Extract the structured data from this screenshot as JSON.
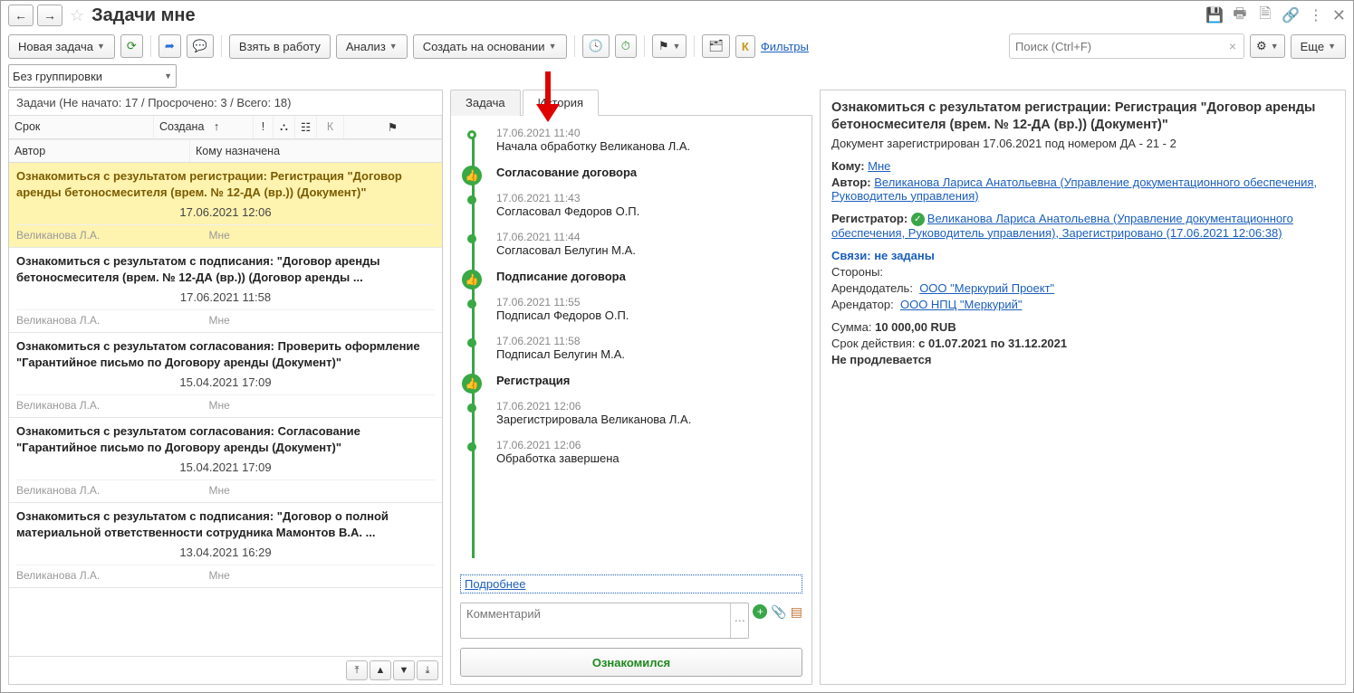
{
  "page_title": "Задачи мне",
  "toolbar": {
    "new_task": "Новая задача",
    "take_work": "Взять в работу",
    "analysis": "Анализ",
    "create_based": "Создать на основании",
    "filters": "Фильтры",
    "more": "Еще"
  },
  "search": {
    "placeholder": "Поиск (Ctrl+F)"
  },
  "grouping": {
    "value": "Без группировки"
  },
  "task_summary": "Задачи (Не начато: 17 / Просрочено: 3 / Всего: 18)",
  "columns": {
    "due": "Срок",
    "created": "Создана",
    "author": "Автор",
    "assigned": "Кому назначена",
    "k": "К"
  },
  "tasks": [
    {
      "title": "Ознакомиться с результатом регистрации: Регистрация \"Договор аренды бетоносмесителя (врем. № 12-ДА (вр.)) (Документ)\"",
      "date": "17.06.2021 12:06",
      "author": "Великанова Л.А.",
      "to": "Мне",
      "selected": true
    },
    {
      "title": "Ознакомиться с результатом с подписания: \"Договор аренды бетоносмесителя (врем. № 12-ДА (вр.)) (Договор аренды ...",
      "date": "17.06.2021 11:58",
      "author": "Великанова Л.А.",
      "to": "Мне"
    },
    {
      "title": "Ознакомиться с результатом согласования: Проверить оформление \"Гарантийное письмо по Договору аренды (Документ)\"",
      "date": "15.04.2021 17:09",
      "author": "Великанова Л.А.",
      "to": "Мне"
    },
    {
      "title": "Ознакомиться с результатом согласования: Согласование \"Гарантийное письмо по Договору аренды (Документ)\"",
      "date": "15.04.2021 17:09",
      "author": "Великанова Л.А.",
      "to": "Мне"
    },
    {
      "title": "Ознакомиться с результатом с подписания: \"Договор о полной материальной ответственности сотрудника Мамонтов В.А. ...",
      "date": "13.04.2021 16:29",
      "author": "Великанова Л.А.",
      "to": "Мне"
    }
  ],
  "tabs": {
    "task": "Задача",
    "history": "История"
  },
  "timeline": [
    {
      "type": "start",
      "dt": "17.06.2021 11:40",
      "txt": "Начала обработку Великанова Л.А."
    },
    {
      "type": "stage",
      "txt": "Согласование договора"
    },
    {
      "type": "item",
      "dt": "17.06.2021 11:43",
      "txt": "Согласовал Федоров О.П."
    },
    {
      "type": "item",
      "dt": "17.06.2021 11:44",
      "txt": "Согласовал Белугин М.А."
    },
    {
      "type": "stage",
      "txt": "Подписание договора"
    },
    {
      "type": "item",
      "dt": "17.06.2021 11:55",
      "txt": "Подписал Федоров О.П."
    },
    {
      "type": "item",
      "dt": "17.06.2021 11:58",
      "txt": "Подписал Белугин М.А."
    },
    {
      "type": "stage",
      "txt": "Регистрация"
    },
    {
      "type": "item",
      "dt": "17.06.2021 12:06",
      "txt": "Зарегистрировала Великанова Л.А."
    },
    {
      "type": "end",
      "dt": "17.06.2021 12:06",
      "txt": "Обработка завершена"
    }
  ],
  "more_link": "Подробнее",
  "comment_placeholder": "Комментарий",
  "ack_button": "Ознакомился",
  "details": {
    "title": "Ознакомиться с результатом регистрации: Регистрация \"Договор аренды бетоносмесителя (врем. № 12-ДА (вр.)) (Документ)\"",
    "registered": "Документ зарегистрирован 17.06.2021 под номером ДА - 21 - 2",
    "to_label": "Кому:",
    "to_value": "Мне",
    "author_label": "Автор:",
    "author_value": "Великанова Лариса Анатольевна (Управление документационного обеспечения, Руководитель управления)",
    "registrar_label": "Регистратор:",
    "registrar_value": "Великанова Лариса Анатольевна (Управление документационного обеспечения, Руководитель управления), Зарегистрировано (17.06.2021 12:06:38)",
    "links_label": "Связи: не заданы",
    "parties_label": "Стороны:",
    "lessor_label": "Арендодатель:",
    "lessor_value": "ООО \"Меркурий Проект\"",
    "lessee_label": "Арендатор:",
    "lessee_value": "ООО НПЦ \"Меркурий\"",
    "sum_label": "Сумма:",
    "sum_value": "10 000,00 RUB",
    "term_label": "Срок действия:",
    "term_value": "с 01.07.2021 по 31.12.2021",
    "prolong": "Не продлевается"
  }
}
